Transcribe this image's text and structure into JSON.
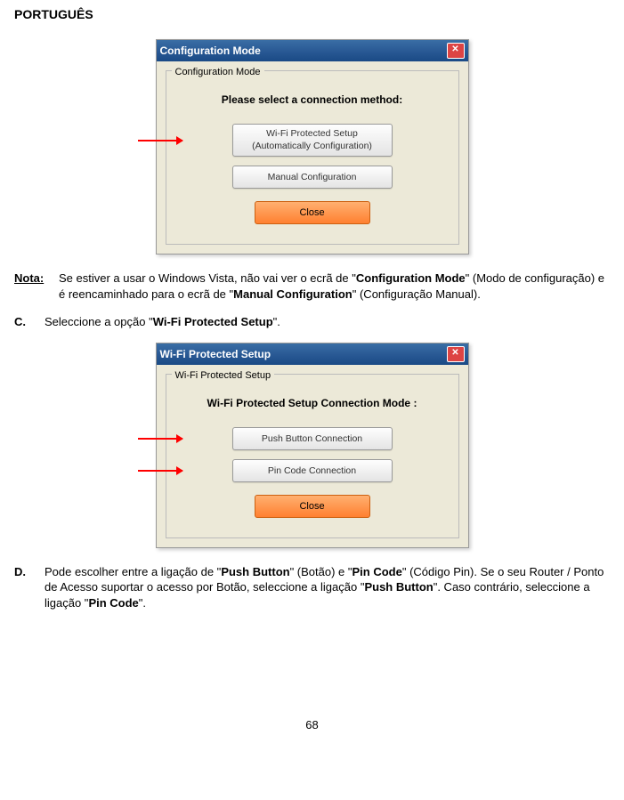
{
  "header": "PORTUGUÊS",
  "dialog1": {
    "title": "Configuration Mode",
    "panel_title": "Configuration Mode",
    "prompt": "Please select a connection method:",
    "btn_wps_line1": "Wi-Fi Protected Setup",
    "btn_wps_line2": "(Automatically Configuration)",
    "btn_manual": "Manual Configuration",
    "btn_close": "Close"
  },
  "nota": {
    "label": "Nota:",
    "text1": "Se estiver a usar o Windows Vista, não vai ver o ecrã de \"",
    "bold1": "Configuration Mode",
    "text2": "\" (Modo de configuração) e é reencaminhado para o ecrã de \"",
    "bold2": "Manual Configuration",
    "text3": "\" (Configuração Manual)."
  },
  "stepC": {
    "label": "C.",
    "text1": "Seleccione a opção \"",
    "bold1": "Wi-Fi Protected Setup",
    "text2": "\"."
  },
  "dialog2": {
    "title": "Wi-Fi Protected Setup",
    "panel_title": "Wi-Fi Protected Setup",
    "prompt": "Wi-Fi Protected Setup Connection  Mode :",
    "btn_push": "Push Button Connection",
    "btn_pin": "Pin Code Connection",
    "btn_close": "Close"
  },
  "stepD": {
    "label": "D.",
    "t1": "Pode escolher entre a ligação de \"",
    "b1": "Push Button",
    "t2": "\" (Botão) e \"",
    "b2": "Pin Code",
    "t3": "\" (Código Pin). Se o seu Router / Ponto de Acesso suportar o acesso por Botão, seleccione a ligação \"",
    "b3": "Push Button",
    "t4": "\". Caso contrário, seleccione a ligação \"",
    "b4": "Pin Code",
    "t5": "\"."
  },
  "page_number": "68"
}
